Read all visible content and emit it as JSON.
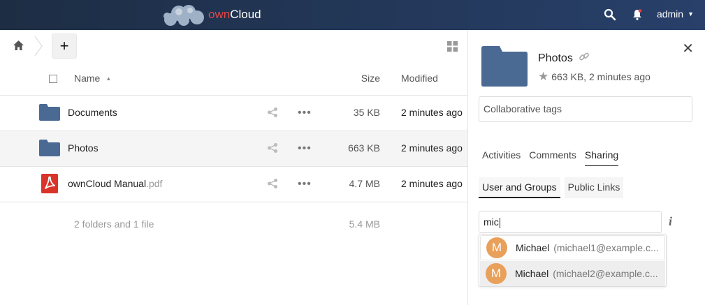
{
  "header": {
    "brand_prefix": "own",
    "brand_suffix": "Cloud",
    "user": "admin"
  },
  "toolbar": {
    "new_label": "+"
  },
  "columns": {
    "name": "Name",
    "size": "Size",
    "modified": "Modified"
  },
  "files": [
    {
      "name": "Documents",
      "ext": "",
      "type": "folder",
      "size": "35 KB",
      "modified": "2 minutes ago"
    },
    {
      "name": "Photos",
      "ext": "",
      "type": "folder",
      "size": "663 KB",
      "modified": "2 minutes ago",
      "selected": true
    },
    {
      "name": "ownCloud Manual",
      "ext": ".pdf",
      "type": "pdf",
      "size": "4.7 MB",
      "modified": "2 minutes ago"
    }
  ],
  "summary": {
    "count": "2 folders and 1 file",
    "total": "5.4 MB"
  },
  "sidebar": {
    "title": "Photos",
    "meta": "663 KB, 2 minutes ago",
    "tags_placeholder": "Collaborative tags",
    "tabs": [
      "Activities",
      "Comments",
      "Sharing"
    ],
    "active_tab": "Sharing",
    "subtabs": [
      "User and Groups",
      "Public Links"
    ],
    "share_input": "mic",
    "suggestions": [
      {
        "initial": "M",
        "name": "Michael",
        "email": "(michael1@example.c..."
      },
      {
        "initial": "M",
        "name": "Michael",
        "email": "(michael2@example.c..."
      }
    ]
  },
  "colors": {
    "header_bg": "#1d2d44",
    "folder": "#4a6a94",
    "pdf": "#d9342b",
    "avatar": "#e8a05a"
  }
}
